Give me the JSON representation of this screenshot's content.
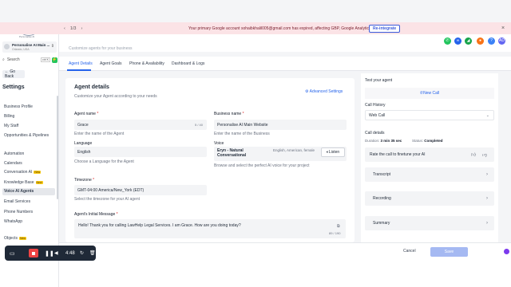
{
  "banner": {
    "pager": "1/3",
    "message": "Your primary Google account sohaibkhalil005@gmail.com has expired, affecting GBP, Google Analytics, etc.",
    "reintegrate": "Re-integrate",
    "close": "×"
  },
  "sidebar": {
    "logo_text": "Personalise AI",
    "account_name": "Personalise AI Main ...",
    "account_sub": "Orlando, USA",
    "search": "Search",
    "kbd": "ctrl K",
    "go_back": "← Go Back",
    "heading": "Settings",
    "items": [
      {
        "label": "Business Profile"
      },
      {
        "label": "Billing"
      },
      {
        "label": "My Staff"
      },
      {
        "label": "Opportunities & Pipelines"
      },
      {
        "label": "Automation"
      },
      {
        "label": "Calendars"
      },
      {
        "label": "Conversation AI",
        "badge": "New"
      },
      {
        "label": "Knowledge Base",
        "badge": "New"
      },
      {
        "label": "Voice AI Agents"
      },
      {
        "label": "Email Services"
      },
      {
        "label": "Phone Numbers"
      },
      {
        "label": "WhatsApp"
      },
      {
        "label": "Objects",
        "badge": "New"
      }
    ]
  },
  "header": {
    "subtitle": "Customize agents for your business"
  },
  "tabs": [
    "Agent Details",
    "Agent Goals",
    "Phone & Availability",
    "Dashboard & Logs"
  ],
  "agent": {
    "title": "Agent details",
    "subtitle": "Customize your Agent according to your needs",
    "advanced": "Advanced Settings",
    "agent_name_label": "Agent name",
    "agent_name_value": "Grace",
    "agent_name_count": "5 / 40",
    "agent_name_hint": "Enter the name of the Agent",
    "business_name_label": "Business name",
    "business_name_value": "Personalise AI Main Website",
    "business_name_hint": "Enter the name of the Business",
    "language_label": "Language",
    "language_value": "English",
    "language_hint": "Choose a Language for the Agent",
    "voice_label": "Voice",
    "voice_name": "Eryn - Natural Conversational",
    "voice_meta": "English, American, female",
    "listen": "Listen",
    "voice_hint": "Browse and select the perfect AI voice for your project",
    "timezone_label": "Timezone",
    "timezone_value": "GMT-04:00 America/New_York (EDT)",
    "timezone_hint": "Select the timezone for your AI agent",
    "initial_label": "Agent's Initial Message",
    "initial_value": "Hello! Thank you for calling LawHelp Legal Services. I am Grace. How are you doing today?",
    "initial_count": "89 / 190"
  },
  "test": {
    "title": "Test your agent",
    "new_call": "New Call",
    "call_history_label": "Call History",
    "call_history_value": "Web Call",
    "call_details": "Call details",
    "duration_label": "Duration:",
    "duration_value": "3 min 35 sec",
    "status_label": "Status:",
    "status_value": "Completed",
    "rate": "Rate the call to finetune your AI",
    "transcript": "Transcript",
    "recording": "Recording",
    "summary": "Summary"
  },
  "footer": {
    "cancel": "Cancel",
    "save": "Save"
  },
  "recorder": {
    "time": "4:48"
  },
  "top_icons": [
    {
      "name": "phone-icon",
      "color": "#22c55e"
    },
    {
      "name": "link-icon",
      "color": "#2563eb"
    },
    {
      "name": "megaphone-icon",
      "color": "#16a34a"
    },
    {
      "name": "bell-icon",
      "color": "#f97316"
    },
    {
      "name": "help-icon",
      "color": "#3b82f6"
    },
    {
      "name": "avatar",
      "color": "#6366f1",
      "label": "AD"
    }
  ]
}
